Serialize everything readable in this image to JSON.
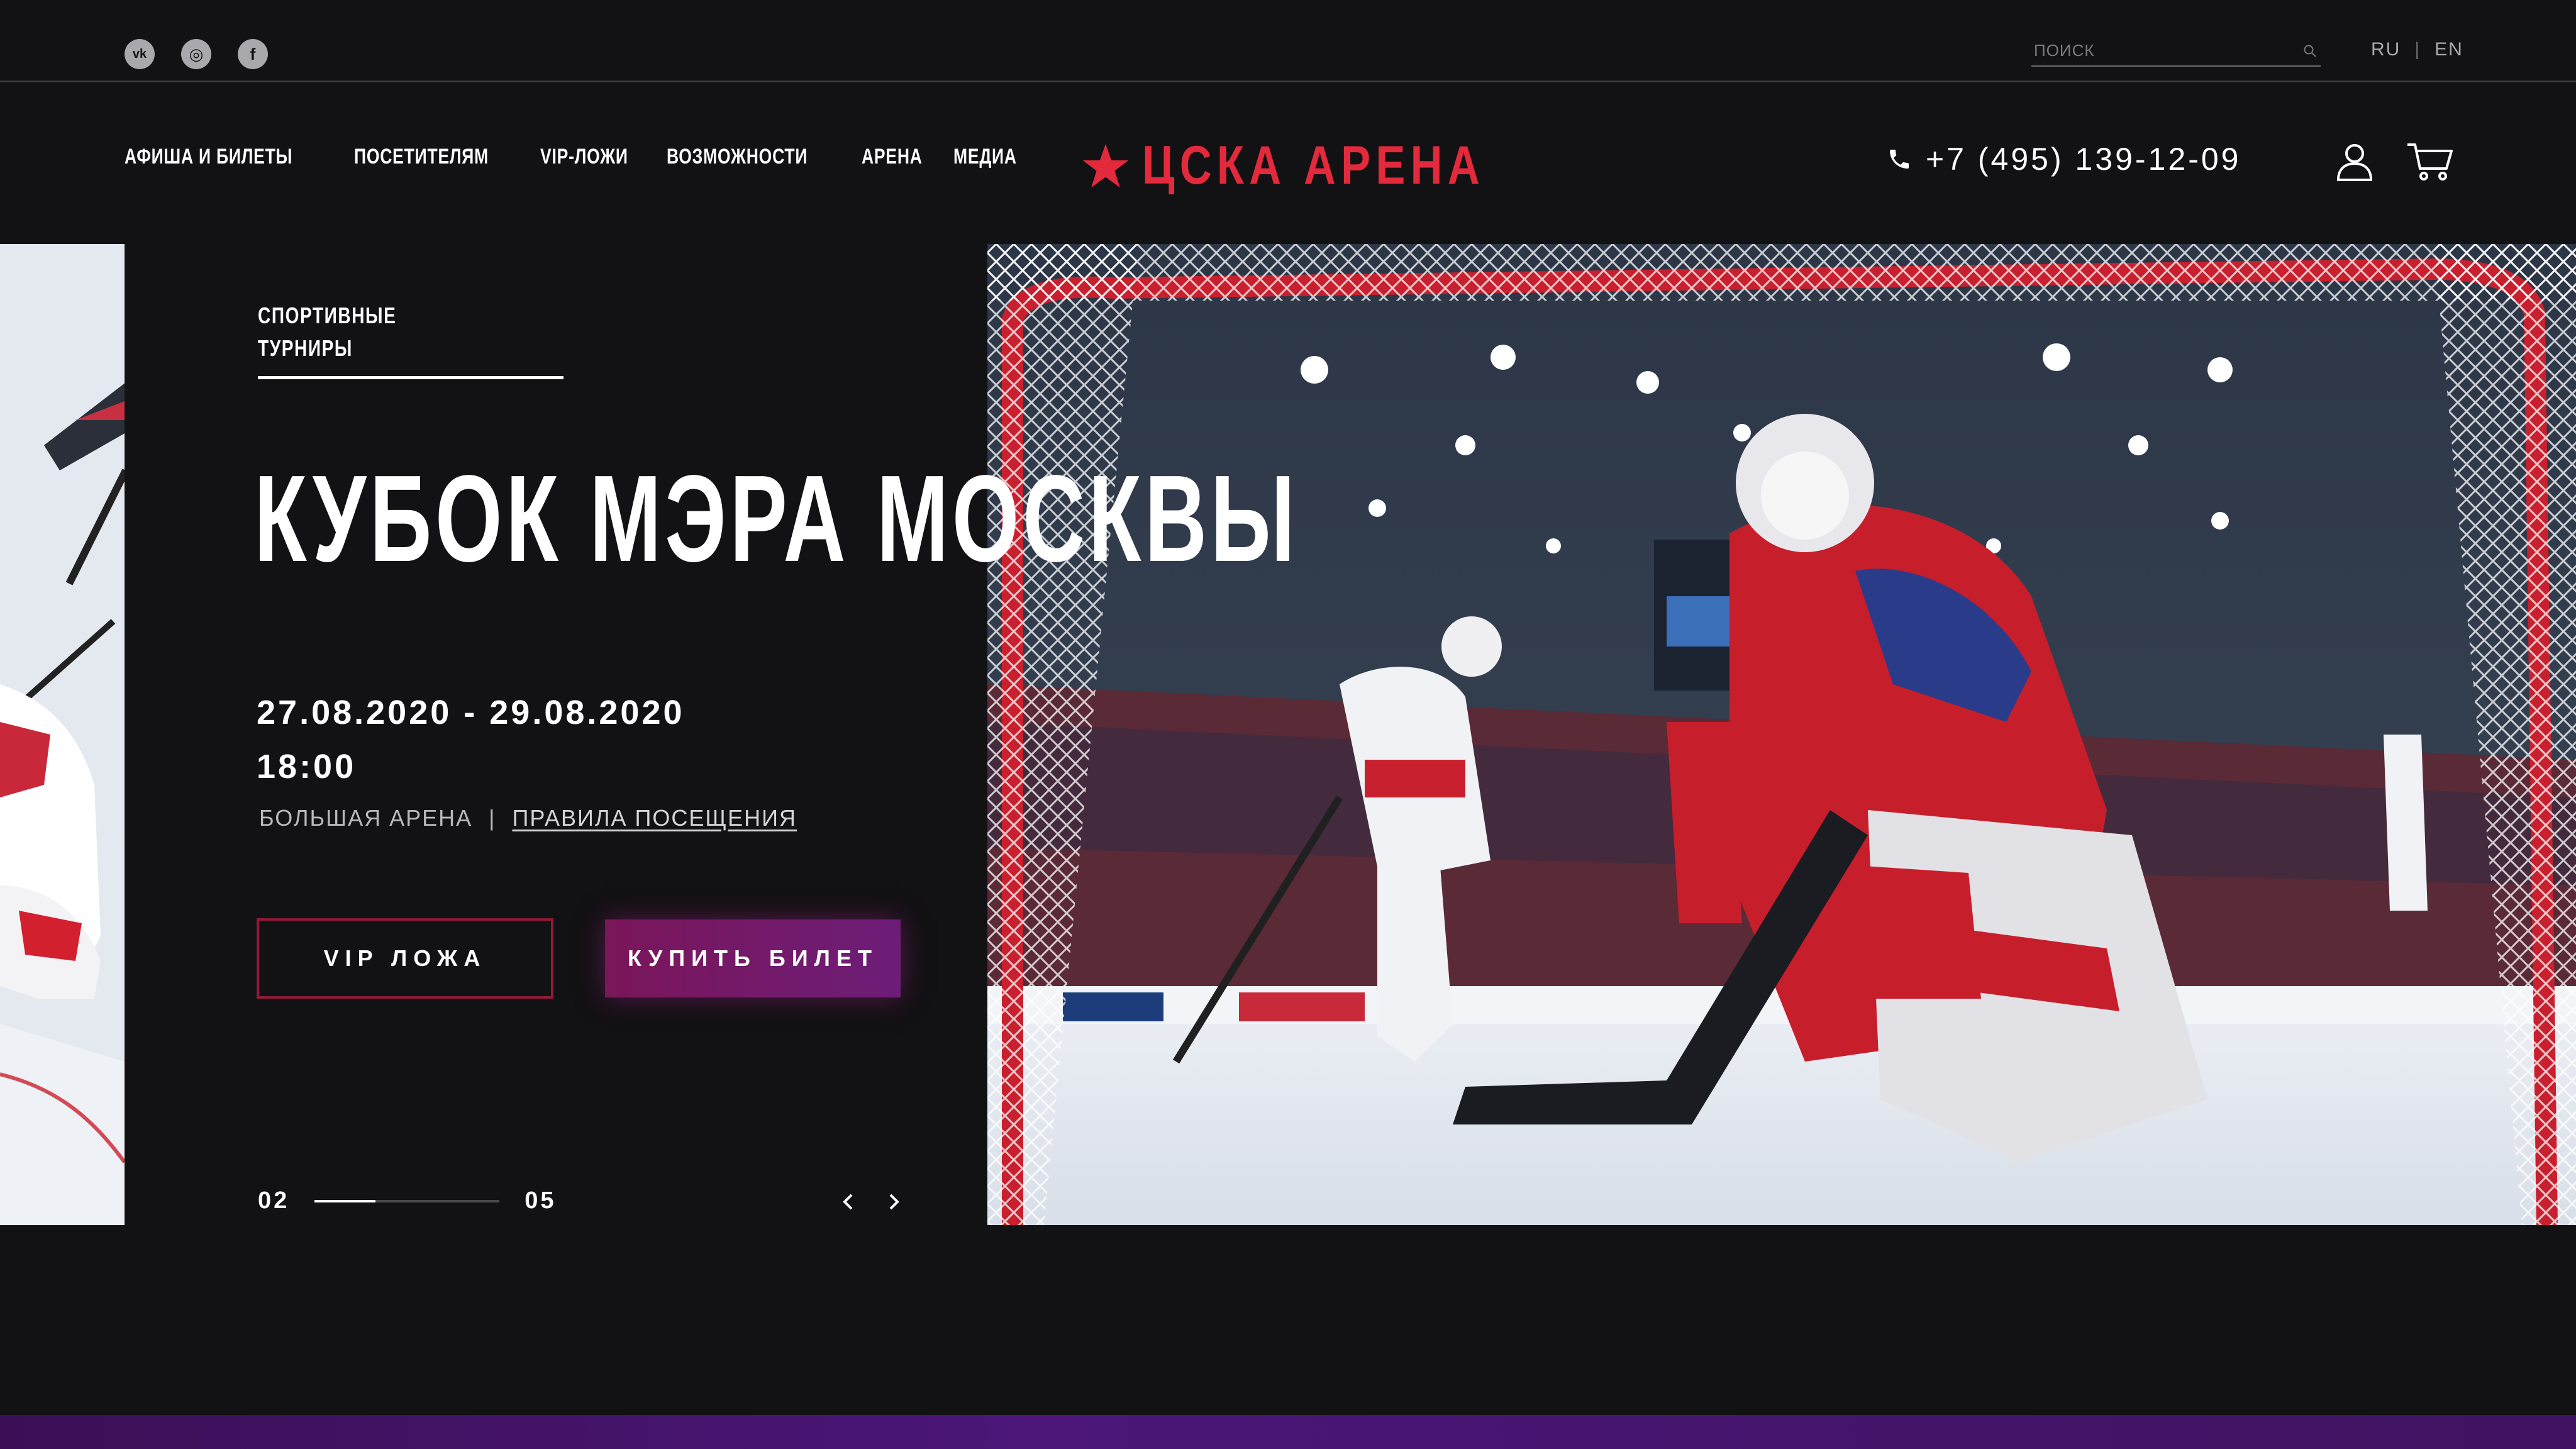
{
  "social": {
    "icons": [
      "vk-icon",
      "instagram-icon",
      "facebook-icon"
    ],
    "glyphs": [
      "vk",
      "◎",
      "f"
    ]
  },
  "search": {
    "placeholder": "ПОИСК"
  },
  "lang": {
    "ru": "RU",
    "separator": "|",
    "en": "EN"
  },
  "nav": {
    "items": [
      "АФИША И БИЛЕТЫ",
      "ПОСЕТИТЕЛЯМ",
      "VIP-ЛОЖИ",
      "ВОЗМОЖНОСТИ",
      "АРЕНА",
      "МЕДИА"
    ]
  },
  "logo": {
    "text": "ЦСКА АРЕНА"
  },
  "phone": {
    "number": "+7 (495) 139-12-09"
  },
  "hero": {
    "category_line1": "СПОРТИВНЫЕ",
    "category_line2": "ТУРНИРЫ",
    "title": "КУБОК МЭРА МОСКВЫ",
    "dates": "27.08.2020 - 29.08.2020",
    "time": "18:00",
    "venue": "БОЛЬШАЯ АРЕНА",
    "venue_separator": "|",
    "rules_link": "ПРАВИЛА ПОСЕЩЕНИЯ",
    "vip_button": "VIP ЛОЖА",
    "buy_button": "КУПИТЬ БИЛЕТ"
  },
  "slider": {
    "current": "02",
    "total": "05",
    "progress": 0.33
  },
  "colors": {
    "background": "#121113",
    "accent_red": "#e32a3c",
    "buy_button": "#7a1659",
    "vip_border": "#8e1b3a"
  }
}
